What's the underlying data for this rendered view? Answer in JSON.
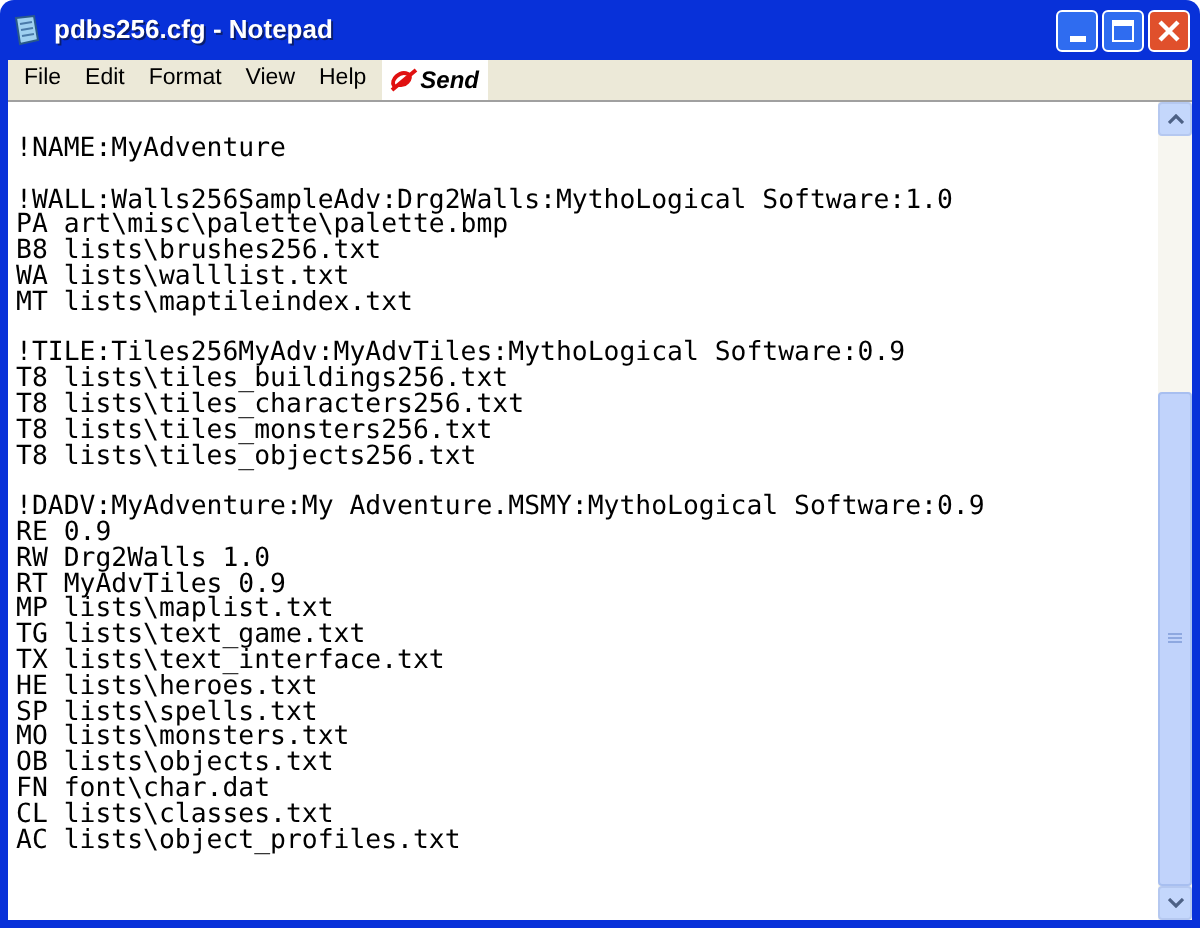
{
  "window": {
    "title": "pdbs256.cfg - Notepad"
  },
  "menu": [
    {
      "label": "File"
    },
    {
      "label": "Edit"
    },
    {
      "label": "Format"
    },
    {
      "label": "View"
    },
    {
      "label": "Help"
    }
  ],
  "send_button": {
    "label": "Send"
  },
  "editor": {
    "blocks": [
      [
        "!NAME:MyAdventure"
      ],
      [
        "!WALL:Walls256SampleAdv:Drg2Walls:MythoLogical Software:1.0",
        "PA art\\misc\\palette\\palette.bmp",
        "B8 lists\\brushes256.txt",
        "WA lists\\walllist.txt",
        "MT lists\\maptileindex.txt"
      ],
      [
        "!TILE:Tiles256MyAdv:MyAdvTiles:MythoLogical Software:0.9",
        "T8 lists\\tiles_buildings256.txt",
        "T8 lists\\tiles_characters256.txt",
        "T8 lists\\tiles_monsters256.txt",
        "T8 lists\\tiles_objects256.txt"
      ],
      [
        "!DADV:MyAdventure:My Adventure.MSMY:MythoLogical Software:0.9",
        "RE 0.9",
        "RW Drg2Walls 1.0",
        "RT MyAdvTiles 0.9",
        "MP lists\\maplist.txt",
        "TG lists\\text_game.txt",
        "TX lists\\text_interface.txt",
        "HE lists\\heroes.txt",
        "SP lists\\spells.txt",
        "MO lists\\monsters.txt",
        "OB lists\\objects.txt",
        "FN font\\char.dat",
        "CL lists\\classes.txt",
        "AC lists\\object_profiles.txt"
      ]
    ]
  }
}
